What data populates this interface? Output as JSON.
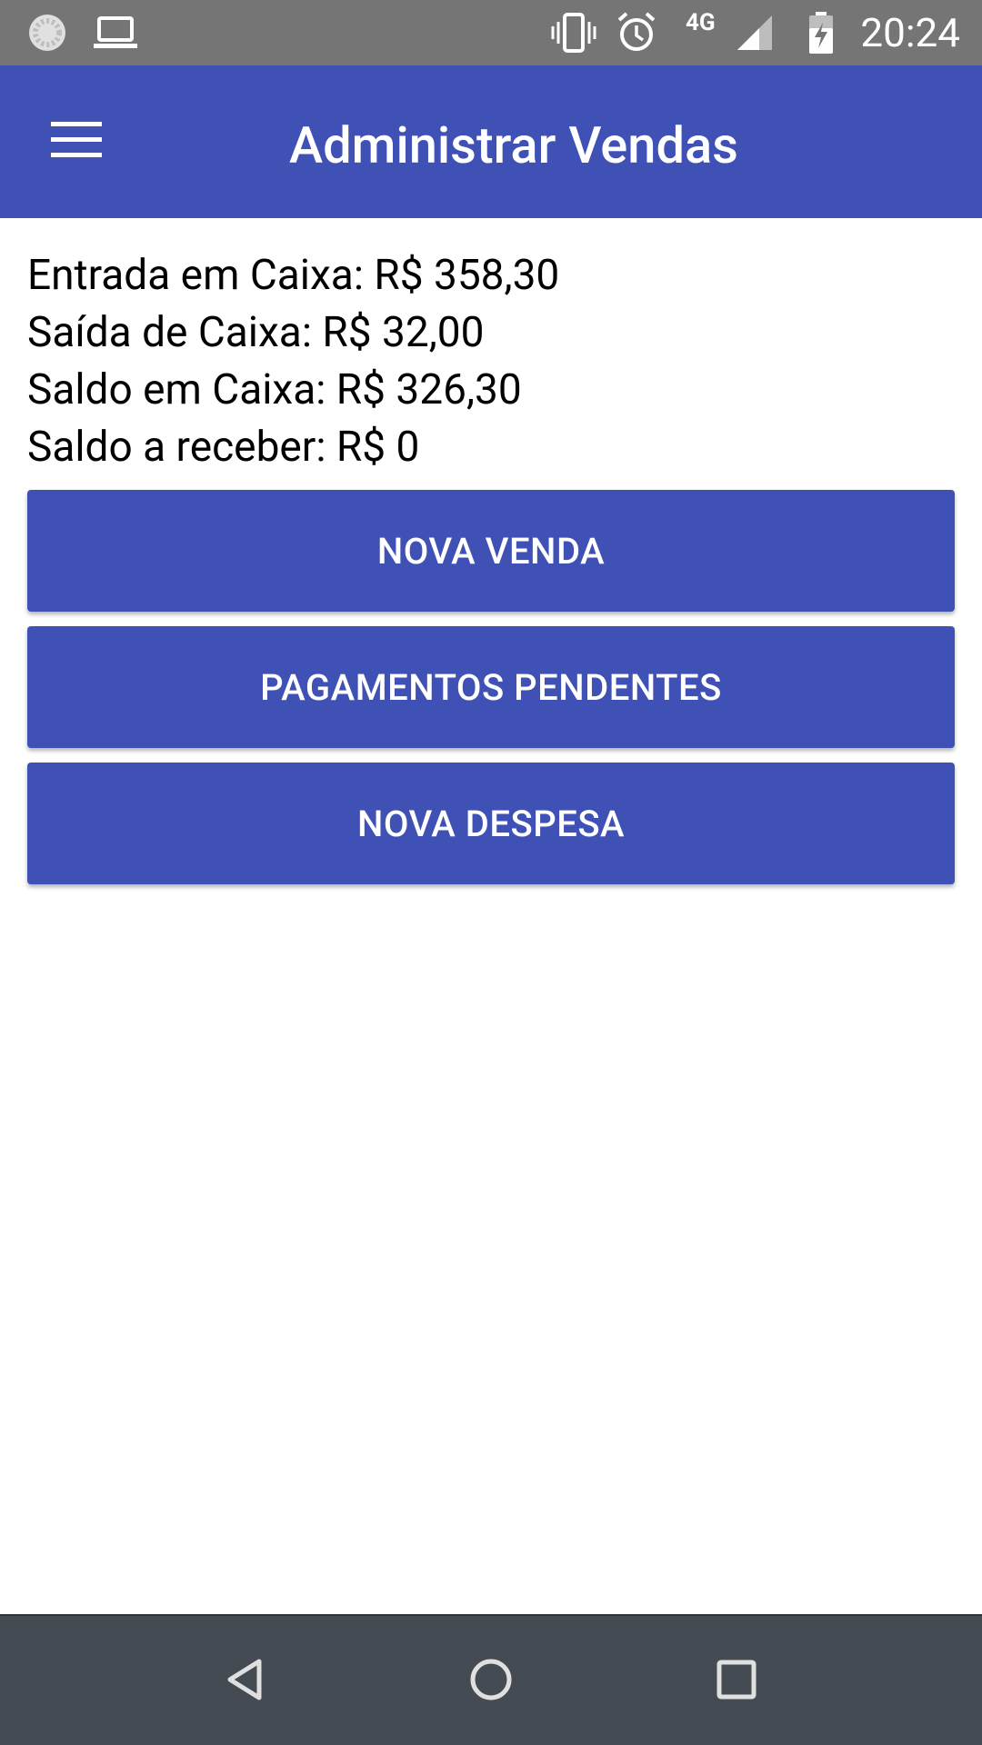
{
  "status_bar": {
    "time": "20:24",
    "network_label": "4G",
    "icons": [
      "loading-circle-icon",
      "laptop-icon",
      "vibrate-icon",
      "alarm-icon",
      "signal-icon",
      "battery-charging-icon"
    ]
  },
  "app_bar": {
    "title": "Administrar Vendas",
    "menu_icon": "hamburger-menu-icon"
  },
  "summary": {
    "entrada": "Entrada em Caixa: R$ 358,30",
    "saida": "Saída de Caixa: R$ 32,00",
    "saldo": "Saldo em Caixa: R$ 326,30",
    "a_receber": "Saldo a receber: R$ 0"
  },
  "actions": {
    "nova_venda": "NOVA VENDA",
    "pagamentos_pendentes": "PAGAMENTOS PENDENTES",
    "nova_despesa": "NOVA DESPESA"
  },
  "nav_bar": {
    "icons": [
      "back-icon",
      "home-icon",
      "recents-icon"
    ]
  },
  "colors": {
    "primary": "#3f51b5",
    "status_bar": "#757575",
    "nav_bar": "#444b52"
  }
}
